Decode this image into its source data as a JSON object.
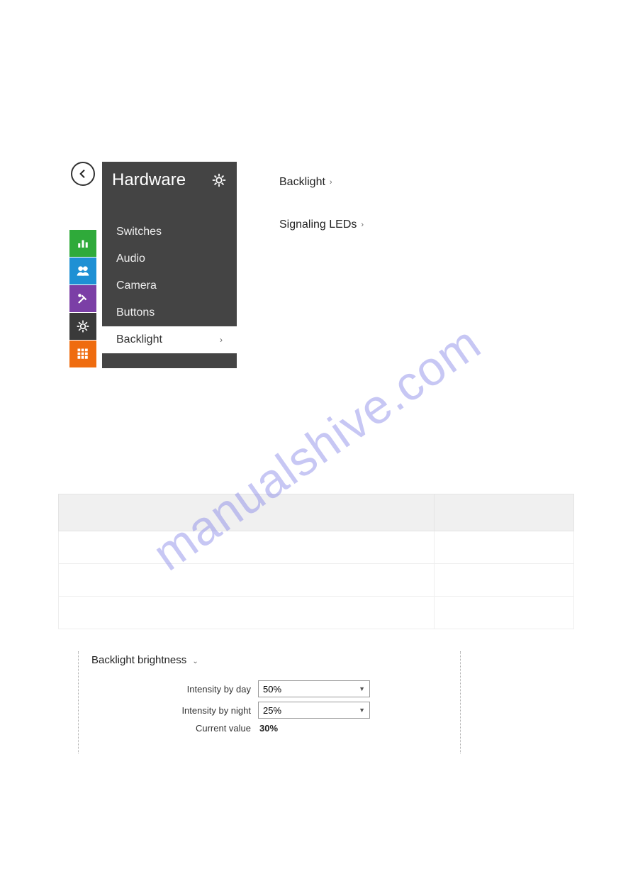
{
  "watermark": "manualshive.com",
  "sidebar": {
    "title": "Hardware",
    "items": [
      {
        "label": "Switches"
      },
      {
        "label": "Audio"
      },
      {
        "label": "Camera"
      },
      {
        "label": "Buttons"
      },
      {
        "label": "Backlight"
      }
    ]
  },
  "content_links": [
    {
      "label": "Backlight"
    },
    {
      "label": "Signaling LEDs"
    }
  ],
  "brightness": {
    "panel_title": "Backlight brightness",
    "row1_label": "Intensity by day",
    "row1_value": "50%",
    "row2_label": "Intensity by night",
    "row2_value": "25%",
    "row3_label": "Current value",
    "row3_value": "30%"
  }
}
